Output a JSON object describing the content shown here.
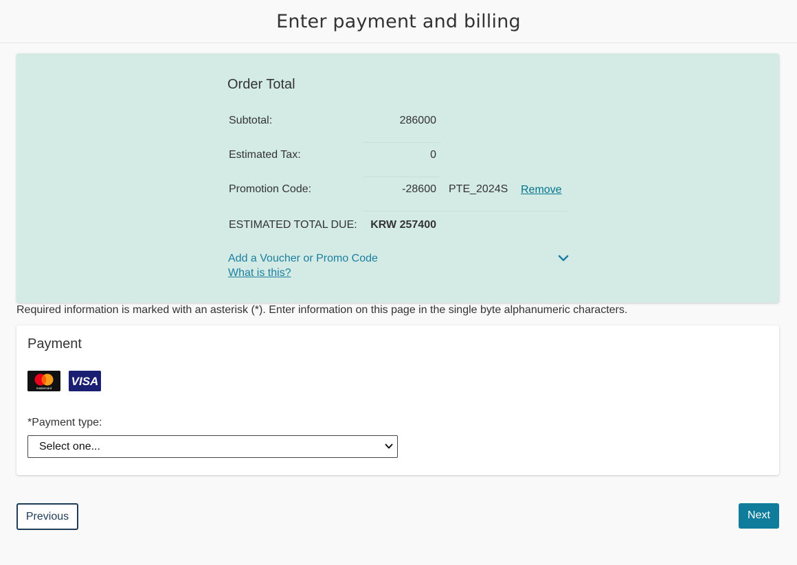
{
  "header": {
    "title": "Enter payment and billing"
  },
  "order": {
    "title": "Order Total",
    "subtotal": {
      "label": "Subtotal:",
      "value": "286000"
    },
    "tax": {
      "label": "Estimated Tax:",
      "value": "0"
    },
    "promotion": {
      "label": "Promotion Code:",
      "value": "-28600",
      "code": "PTE_2024S",
      "remove_label": "Remove"
    },
    "total": {
      "label": "ESTIMATED TOTAL DUE:",
      "value": "KRW 257400"
    },
    "voucher_link": "Add a Voucher or Promo Code",
    "what_link": "What is this?"
  },
  "required_note": "Required information is marked with an asterisk (*). Enter information on this page in the single byte alphanumeric characters.",
  "payment": {
    "title": "Payment",
    "logos": [
      "mastercard",
      "VISA"
    ],
    "type_label": "*Payment type:",
    "type_selected": "Select one..."
  },
  "nav": {
    "previous_label": "Previous",
    "next_label": "Next"
  },
  "colors": {
    "panel": "#d4eae4",
    "link": "#1b7fa0",
    "next_button": "#0f7c9c",
    "prev_border": "#1d3b57"
  },
  "icons": {
    "expand": "chevron-down-icon",
    "select_arrow": "chevron-down-icon"
  }
}
